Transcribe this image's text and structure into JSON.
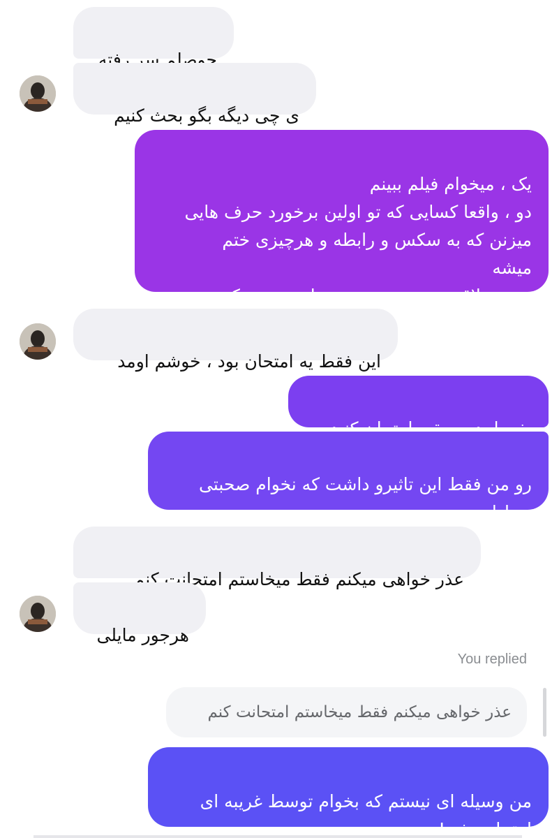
{
  "conversation": {
    "messages": [
      {
        "sender": "them",
        "text": "حوصلم سر رفته"
      },
      {
        "sender": "them",
        "text": "ی چی دیگه بگو بحث کنیم"
      },
      {
        "sender": "me",
        "text": "یک ، میخوام فیلم ببینم\nدو ، واقعا کسایی که تو اولین برخورد حرف هایی\nمیزنن که به سکس و رابطه و هرچیزی ختم\nمیشه\nمورد علاقه من نیستن و نمیخوام صحبت کنم"
      },
      {
        "sender": "them",
        "text": "این فقط یه امتحان بود ، خوشم اومد"
      },
      {
        "sender": "me",
        "text": "بفرمایید رو بقیه امتحان کنید"
      },
      {
        "sender": "me",
        "text": "رو من فقط این تاثیرو داشت که نخوام صحبتی\nرو ادامه بدم"
      },
      {
        "sender": "them",
        "text": "عذر خواهی میکنم فقط میخاستم امتحانت کنم"
      },
      {
        "sender": "them",
        "text": "هرجور مایلی"
      },
      {
        "sender": "me",
        "text": "من وسیله ای نیستم که بخوام توسط غریبه ای\nامتحان بشم!"
      }
    ],
    "reply": {
      "label": "You replied",
      "quoted_text": "عذر خواهی میکنم فقط میخاستم امتحانت کنم"
    },
    "colors": {
      "incoming_bubble": "#f0f0f4",
      "outgoing_top": "#9a35e6",
      "outgoing_bottom": "#5b51f5"
    }
  }
}
